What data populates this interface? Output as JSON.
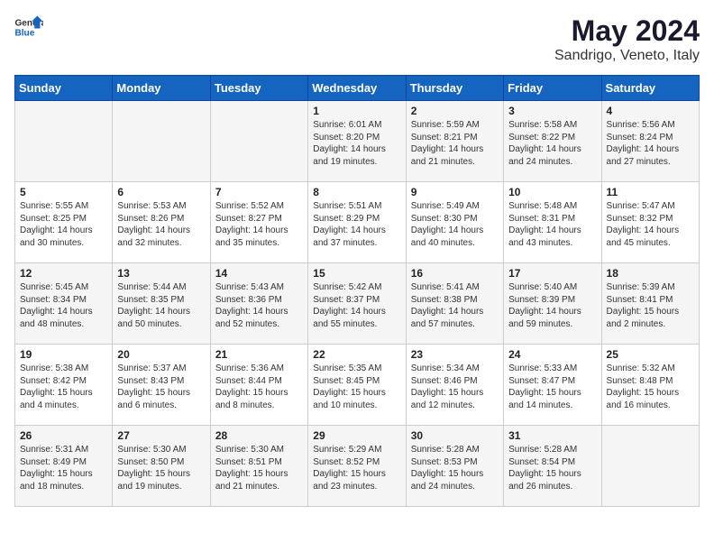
{
  "header": {
    "logo_general": "General",
    "logo_blue": "Blue",
    "title": "May 2024",
    "subtitle": "Sandrigo, Veneto, Italy"
  },
  "days_of_week": [
    "Sunday",
    "Monday",
    "Tuesday",
    "Wednesday",
    "Thursday",
    "Friday",
    "Saturday"
  ],
  "weeks": [
    [
      {
        "day": "",
        "content": ""
      },
      {
        "day": "",
        "content": ""
      },
      {
        "day": "",
        "content": ""
      },
      {
        "day": "1",
        "content": "Sunrise: 6:01 AM\nSunset: 8:20 PM\nDaylight: 14 hours\nand 19 minutes."
      },
      {
        "day": "2",
        "content": "Sunrise: 5:59 AM\nSunset: 8:21 PM\nDaylight: 14 hours\nand 21 minutes."
      },
      {
        "day": "3",
        "content": "Sunrise: 5:58 AM\nSunset: 8:22 PM\nDaylight: 14 hours\nand 24 minutes."
      },
      {
        "day": "4",
        "content": "Sunrise: 5:56 AM\nSunset: 8:24 PM\nDaylight: 14 hours\nand 27 minutes."
      }
    ],
    [
      {
        "day": "5",
        "content": "Sunrise: 5:55 AM\nSunset: 8:25 PM\nDaylight: 14 hours\nand 30 minutes."
      },
      {
        "day": "6",
        "content": "Sunrise: 5:53 AM\nSunset: 8:26 PM\nDaylight: 14 hours\nand 32 minutes."
      },
      {
        "day": "7",
        "content": "Sunrise: 5:52 AM\nSunset: 8:27 PM\nDaylight: 14 hours\nand 35 minutes."
      },
      {
        "day": "8",
        "content": "Sunrise: 5:51 AM\nSunset: 8:29 PM\nDaylight: 14 hours\nand 37 minutes."
      },
      {
        "day": "9",
        "content": "Sunrise: 5:49 AM\nSunset: 8:30 PM\nDaylight: 14 hours\nand 40 minutes."
      },
      {
        "day": "10",
        "content": "Sunrise: 5:48 AM\nSunset: 8:31 PM\nDaylight: 14 hours\nand 43 minutes."
      },
      {
        "day": "11",
        "content": "Sunrise: 5:47 AM\nSunset: 8:32 PM\nDaylight: 14 hours\nand 45 minutes."
      }
    ],
    [
      {
        "day": "12",
        "content": "Sunrise: 5:45 AM\nSunset: 8:34 PM\nDaylight: 14 hours\nand 48 minutes."
      },
      {
        "day": "13",
        "content": "Sunrise: 5:44 AM\nSunset: 8:35 PM\nDaylight: 14 hours\nand 50 minutes."
      },
      {
        "day": "14",
        "content": "Sunrise: 5:43 AM\nSunset: 8:36 PM\nDaylight: 14 hours\nand 52 minutes."
      },
      {
        "day": "15",
        "content": "Sunrise: 5:42 AM\nSunset: 8:37 PM\nDaylight: 14 hours\nand 55 minutes."
      },
      {
        "day": "16",
        "content": "Sunrise: 5:41 AM\nSunset: 8:38 PM\nDaylight: 14 hours\nand 57 minutes."
      },
      {
        "day": "17",
        "content": "Sunrise: 5:40 AM\nSunset: 8:39 PM\nDaylight: 14 hours\nand 59 minutes."
      },
      {
        "day": "18",
        "content": "Sunrise: 5:39 AM\nSunset: 8:41 PM\nDaylight: 15 hours\nand 2 minutes."
      }
    ],
    [
      {
        "day": "19",
        "content": "Sunrise: 5:38 AM\nSunset: 8:42 PM\nDaylight: 15 hours\nand 4 minutes."
      },
      {
        "day": "20",
        "content": "Sunrise: 5:37 AM\nSunset: 8:43 PM\nDaylight: 15 hours\nand 6 minutes."
      },
      {
        "day": "21",
        "content": "Sunrise: 5:36 AM\nSunset: 8:44 PM\nDaylight: 15 hours\nand 8 minutes."
      },
      {
        "day": "22",
        "content": "Sunrise: 5:35 AM\nSunset: 8:45 PM\nDaylight: 15 hours\nand 10 minutes."
      },
      {
        "day": "23",
        "content": "Sunrise: 5:34 AM\nSunset: 8:46 PM\nDaylight: 15 hours\nand 12 minutes."
      },
      {
        "day": "24",
        "content": "Sunrise: 5:33 AM\nSunset: 8:47 PM\nDaylight: 15 hours\nand 14 minutes."
      },
      {
        "day": "25",
        "content": "Sunrise: 5:32 AM\nSunset: 8:48 PM\nDaylight: 15 hours\nand 16 minutes."
      }
    ],
    [
      {
        "day": "26",
        "content": "Sunrise: 5:31 AM\nSunset: 8:49 PM\nDaylight: 15 hours\nand 18 minutes."
      },
      {
        "day": "27",
        "content": "Sunrise: 5:30 AM\nSunset: 8:50 PM\nDaylight: 15 hours\nand 19 minutes."
      },
      {
        "day": "28",
        "content": "Sunrise: 5:30 AM\nSunset: 8:51 PM\nDaylight: 15 hours\nand 21 minutes."
      },
      {
        "day": "29",
        "content": "Sunrise: 5:29 AM\nSunset: 8:52 PM\nDaylight: 15 hours\nand 23 minutes."
      },
      {
        "day": "30",
        "content": "Sunrise: 5:28 AM\nSunset: 8:53 PM\nDaylight: 15 hours\nand 24 minutes."
      },
      {
        "day": "31",
        "content": "Sunrise: 5:28 AM\nSunset: 8:54 PM\nDaylight: 15 hours\nand 26 minutes."
      },
      {
        "day": "",
        "content": ""
      }
    ]
  ]
}
